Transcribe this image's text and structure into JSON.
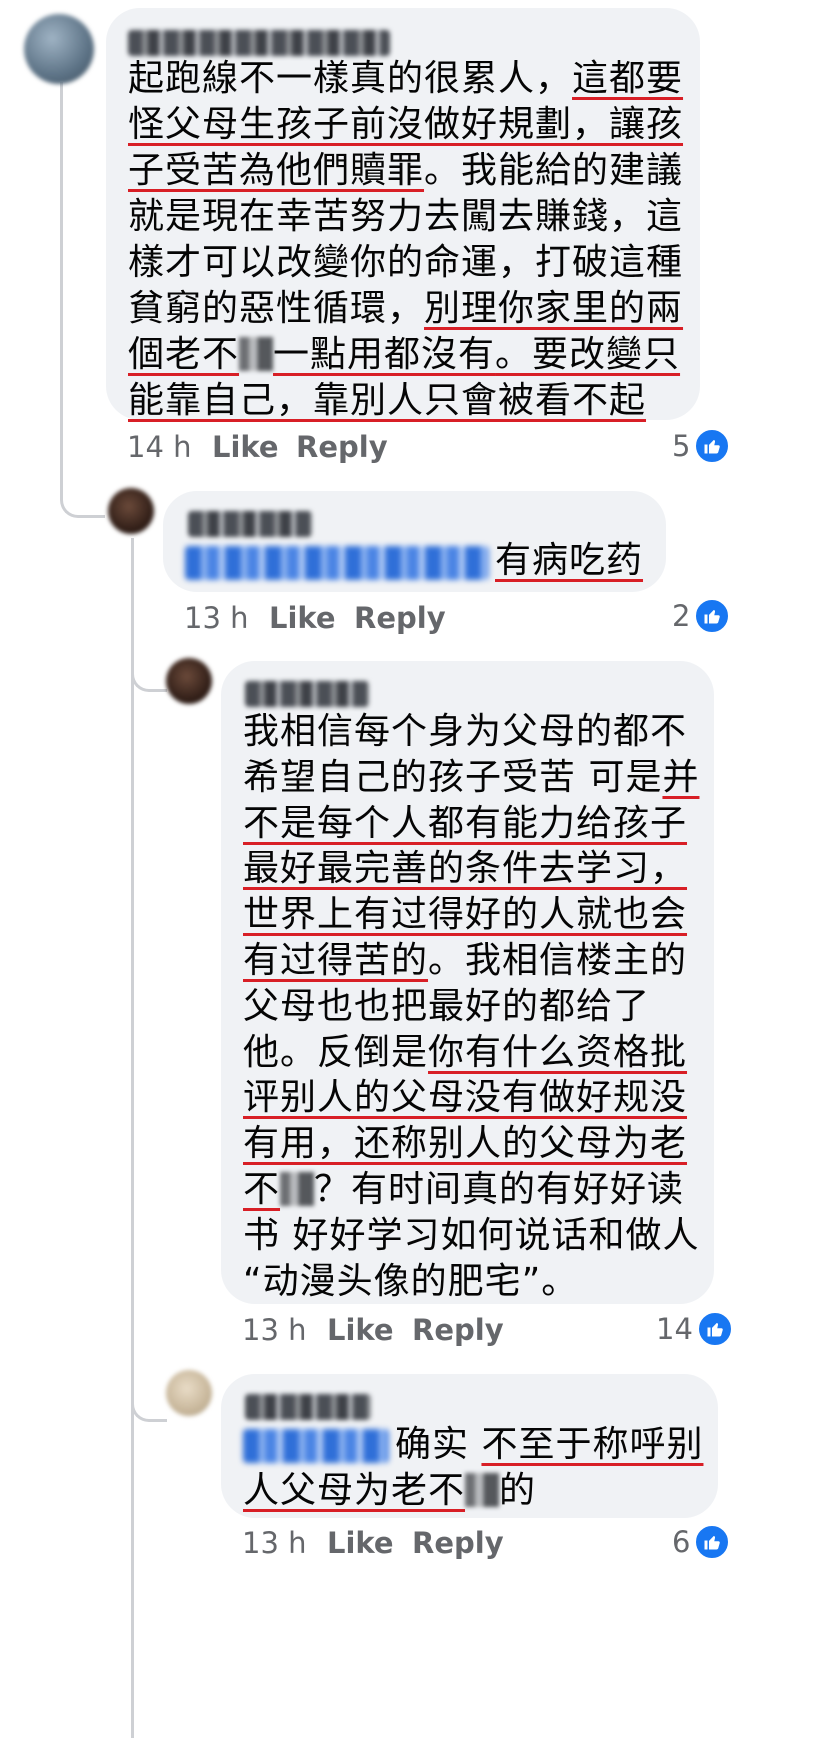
{
  "comments": [
    {
      "id": "c1",
      "author": "Hikigaya Hachiman",
      "lines": [
        [
          {
            "t": "起跑線不一樣真的很累人，"
          },
          {
            "t": "這都要",
            "u": true
          }
        ],
        [
          {
            "t": "怪父母生孩子前沒做好規劃，讓孩",
            "u": true
          }
        ],
        [
          {
            "t": "子受苦為他們贖罪",
            "u": true
          },
          {
            "t": "。我能給的建議"
          }
        ],
        [
          {
            "t": "就是現在幸苦努力去闖去賺錢，這"
          }
        ],
        [
          {
            "t": "樣才可以改變你的命運，打破這種"
          }
        ],
        [
          {
            "t": "貧窮的惡性循環，"
          },
          {
            "t": "別理你家里的兩",
            "u": true
          }
        ],
        [
          {
            "t": "個老不",
            "u": true
          },
          {
            "c": true
          },
          {
            "t": "一點用都沒有",
            "u": true
          },
          {
            "t": "。要改變只",
            "u": true
          }
        ],
        [
          {
            "t": "能靠自己，靠別人只會被看不起",
            "u": true
          }
        ]
      ],
      "time": "14 h",
      "like": "Like",
      "reply": "Reply",
      "reactions": "5"
    },
    {
      "id": "c2",
      "author": "Jing Xian",
      "mention": "Hikigaya Hachiman",
      "lines": [
        [
          {
            "t": "有病吃药",
            "u": true
          }
        ]
      ],
      "time": "13 h",
      "like": "Like",
      "reply": "Reply",
      "reactions": "2"
    },
    {
      "id": "c3",
      "author": "Jing Xian",
      "lines": [
        [
          {
            "t": "我相信每个身为父母的都不"
          }
        ],
        [
          {
            "t": "希望自己的孩子受苦 可是"
          },
          {
            "t": "并",
            "u": true
          }
        ],
        [
          {
            "t": "不是每个人都有能力给孩子",
            "u": true
          }
        ],
        [
          {
            "t": "最好最完善的条件去学习，",
            "u": true
          }
        ],
        [
          {
            "t": "世界上有过得好的人就也会",
            "u": true
          }
        ],
        [
          {
            "t": "有过得苦的",
            "u": true
          },
          {
            "t": "。我相信楼主的"
          }
        ],
        [
          {
            "t": "父母也也把最好的都给了"
          }
        ],
        [
          {
            "t": "他。反倒是"
          },
          {
            "t": "你有什么资格批",
            "u": true
          }
        ],
        [
          {
            "t": "评别人的父母没有做好规没",
            "u": true
          }
        ],
        [
          {
            "t": "有用，还称别人的父母为老",
            "u": true
          }
        ],
        [
          {
            "t": "不",
            "u": true
          },
          {
            "c": true
          },
          {
            "t": "？有时间真的有好好读"
          }
        ],
        [
          {
            "t": "书 好好学习如何说话和做人"
          }
        ],
        [
          {
            "t": "“动漫头像的肥宅”。"
          }
        ]
      ],
      "time": "13 h",
      "like": "Like",
      "reply": "Reply",
      "reactions": "14"
    },
    {
      "id": "c4",
      "author": "Jia Wei",
      "mention": "Jing Xian",
      "lines": [
        [
          {
            "t": "确实 "
          },
          {
            "t": "不至于称呼别",
            "u": true
          }
        ],
        [
          {
            "t": "人父母为老不",
            "u": true
          },
          {
            "c": true
          },
          {
            "t": "的"
          }
        ]
      ],
      "time": "13 h",
      "like": "Like",
      "reply": "Reply",
      "reactions": "6"
    }
  ],
  "colors": {
    "bubble": "#f0f2f5",
    "meta": "#65676b",
    "underline": "#d81f26",
    "like_blue": "#1877f2"
  }
}
